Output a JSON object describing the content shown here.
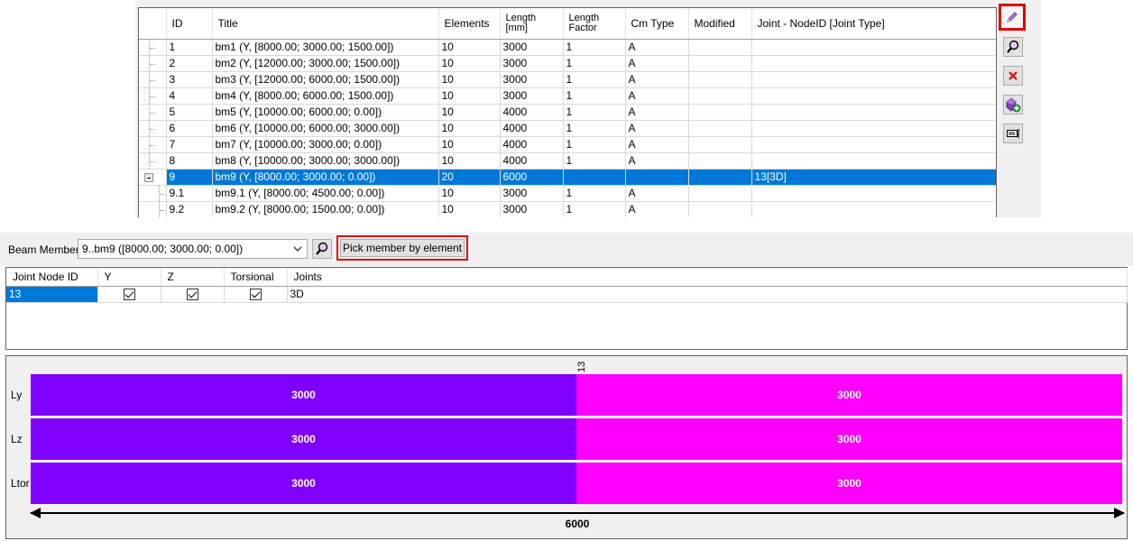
{
  "grid": {
    "columns": [
      "ID",
      "Title",
      "Elements",
      "Length\n[mm]",
      "Length\nFactor",
      "Cm Type",
      "Modified",
      "Joint - NodeID [Joint Type]"
    ],
    "column_length_lines": [
      "Length",
      "[mm]"
    ],
    "column_factor_lines": [
      "Length",
      "Factor"
    ],
    "rows": [
      {
        "id": "1",
        "title": "bm1 (Y, [8000.00; 3000.00; 1500.00])",
        "elements": "10",
        "length": "3000",
        "factor": "1",
        "cm": "A",
        "modified": "",
        "joint": ""
      },
      {
        "id": "2",
        "title": "bm2 (Y, [12000.00; 3000.00; 1500.00])",
        "elements": "10",
        "length": "3000",
        "factor": "1",
        "cm": "A",
        "modified": "",
        "joint": ""
      },
      {
        "id": "3",
        "title": "bm3 (Y, [12000.00; 6000.00; 1500.00])",
        "elements": "10",
        "length": "3000",
        "factor": "1",
        "cm": "A",
        "modified": "",
        "joint": ""
      },
      {
        "id": "4",
        "title": "bm4 (Y, [8000.00; 6000.00; 1500.00])",
        "elements": "10",
        "length": "3000",
        "factor": "1",
        "cm": "A",
        "modified": "",
        "joint": ""
      },
      {
        "id": "5",
        "title": "bm5 (Y, [10000.00; 6000.00; 0.00])",
        "elements": "10",
        "length": "4000",
        "factor": "1",
        "cm": "A",
        "modified": "",
        "joint": ""
      },
      {
        "id": "6",
        "title": "bm6 (Y, [10000.00; 6000.00; 3000.00])",
        "elements": "10",
        "length": "4000",
        "factor": "1",
        "cm": "A",
        "modified": "",
        "joint": ""
      },
      {
        "id": "7",
        "title": "bm7 (Y, [10000.00; 3000.00; 0.00])",
        "elements": "10",
        "length": "4000",
        "factor": "1",
        "cm": "A",
        "modified": "",
        "joint": ""
      },
      {
        "id": "8",
        "title": "bm8 (Y, [10000.00; 3000.00; 3000.00])",
        "elements": "10",
        "length": "4000",
        "factor": "1",
        "cm": "A",
        "modified": "",
        "joint": ""
      },
      {
        "id": "9",
        "title": "bm9 (Y, [8000.00; 3000.00; 0.00])",
        "elements": "20",
        "length": "6000",
        "factor": "",
        "cm": "",
        "modified": "",
        "joint": "13[3D]"
      },
      {
        "id": "9.1",
        "title": "bm9.1 (Y, [8000.00; 4500.00; 0.00])",
        "elements": "10",
        "length": "3000",
        "factor": "1",
        "cm": "A",
        "modified": "",
        "joint": ""
      },
      {
        "id": "9.2",
        "title": "bm9.2 (Y, [8000.00; 1500.00; 0.00])",
        "elements": "10",
        "length": "3000",
        "factor": "1",
        "cm": "A",
        "modified": "",
        "joint": ""
      }
    ]
  },
  "toolbar": {
    "icons": [
      "pencil-icon",
      "magnifier-icon",
      "delete-icon",
      "add-member-icon",
      "properties-icon"
    ]
  },
  "member": {
    "label": "Beam Member",
    "selected": "9..bm9 ([8000.00; 3000.00; 0.00])",
    "pick_label": "Pick member by element"
  },
  "joints": {
    "columns": [
      "Joint Node ID",
      "Y",
      "Z",
      "Torsional",
      "Joints"
    ],
    "rows": [
      {
        "node": "13",
        "y": true,
        "z": true,
        "torsional": true,
        "joints": "3D"
      }
    ]
  },
  "diagram": {
    "node_label": "13",
    "rows": [
      {
        "label": "Ly",
        "segments": [
          "3000",
          "3000"
        ]
      },
      {
        "label": "Lz",
        "segments": [
          "3000",
          "3000"
        ]
      },
      {
        "label": "Ltor",
        "segments": [
          "3000",
          "3000"
        ]
      }
    ],
    "total": "6000",
    "colors": {
      "segment_left": "#7f00ff",
      "segment_right": "#ff00ff"
    }
  },
  "colors": {
    "selection": "#0078d7",
    "highlight_border": "#e00000"
  }
}
